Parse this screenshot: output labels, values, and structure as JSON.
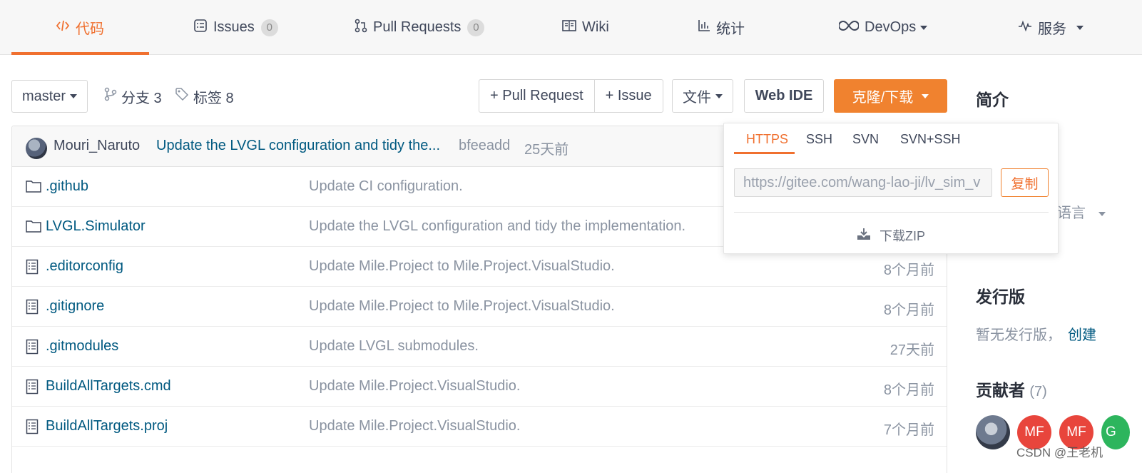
{
  "nav": {
    "tabs": [
      {
        "label": "代码",
        "icon": "code-icon"
      },
      {
        "label": "Issues",
        "icon": "issues-icon",
        "count": "0"
      },
      {
        "label": "Pull Requests",
        "icon": "pull-request-icon",
        "count": "0"
      },
      {
        "label": "Wiki",
        "icon": "book-icon"
      },
      {
        "label": "统计",
        "icon": "bar-chart-icon"
      },
      {
        "label": "DevOps",
        "icon": "infinity-icon"
      },
      {
        "label": "服务",
        "icon": "pulse-icon"
      }
    ]
  },
  "toolbar": {
    "branch": "master",
    "branches": "分支 3",
    "tags": "标签 8",
    "pull_request": "+ Pull Request",
    "issue": "+ Issue",
    "file": "文件",
    "web_ide": "Web IDE",
    "clone": "克隆/下载"
  },
  "commit": {
    "author": "Mouri_Naruto",
    "message": "Update the LVGL configuration and tidy the...",
    "hash": "bfeeadd",
    "time": "25天前"
  },
  "files": [
    {
      "name": ".github",
      "type": "folder",
      "message": "Update CI configuration.",
      "time": ""
    },
    {
      "name": "LVGL.Simulator",
      "type": "folder",
      "message": "Update the LVGL configuration and tidy the implementation.",
      "time": ""
    },
    {
      "name": ".editorconfig",
      "type": "file",
      "message": "Update Mile.Project to Mile.Project.VisualStudio.",
      "time": "8个月前"
    },
    {
      "name": ".gitignore",
      "type": "file",
      "message": "Update Mile.Project to Mile.Project.VisualStudio.",
      "time": "8个月前"
    },
    {
      "name": ".gitmodules",
      "type": "file",
      "message": "Update LVGL submodules.",
      "time": "27天前"
    },
    {
      "name": "BuildAllTargets.cmd",
      "type": "file",
      "message": "Update Mile.Project.VisualStudio.",
      "time": "8个月前"
    },
    {
      "name": "BuildAllTargets.proj",
      "type": "file",
      "message": "Update Mile.Project.VisualStudio.",
      "time": "7个月前"
    }
  ],
  "sidebar": {
    "intro_title": "简介",
    "language_partial": "语言",
    "release_title": "发行版",
    "release_text": "暂无发行版，",
    "release_link": "创建",
    "contrib_title": "贡献者",
    "contrib_count": "(7)",
    "contributors": [
      {
        "initials": "",
        "color": "#5b6478"
      },
      {
        "initials": "MF",
        "color": "#e8453c"
      },
      {
        "initials": "MF",
        "color": "#e8453c"
      },
      {
        "initials": "G",
        "color": "#2db55d"
      }
    ]
  },
  "clone_dropdown": {
    "tabs": [
      "HTTPS",
      "SSH",
      "SVN",
      "SVN+SSH"
    ],
    "url": "https://gitee.com/wang-lao-ji/lv_sim_v",
    "copy": "复制",
    "download_zip": "下载ZIP"
  },
  "watermark": "CSDN @王老机",
  "colors": {
    "accent": "#f0702f",
    "link": "#005980",
    "muted": "#8a93a1"
  }
}
